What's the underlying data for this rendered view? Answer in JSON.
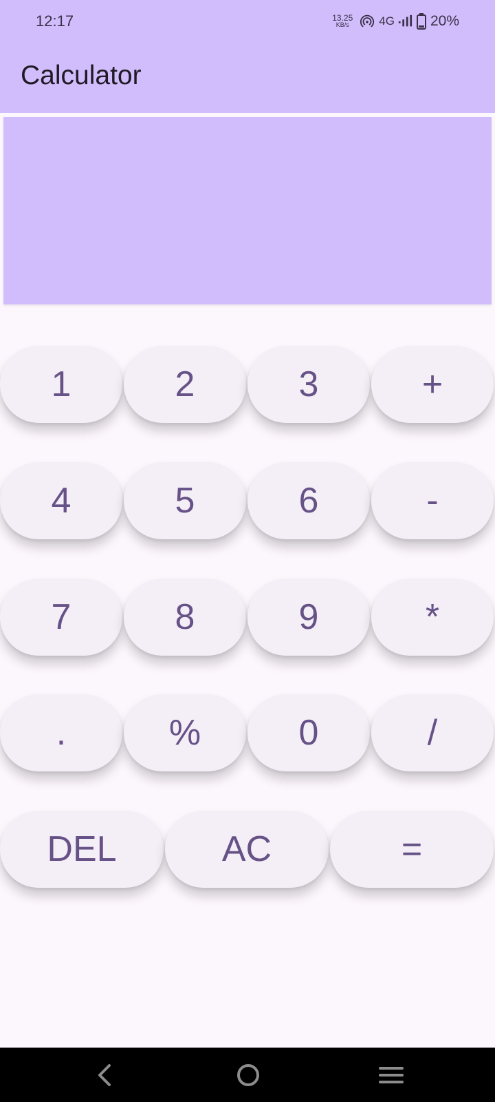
{
  "status_bar": {
    "time": "12:17",
    "net_speed_value": "13.25",
    "net_speed_unit": "KB/s",
    "network_type": "4G",
    "battery": "20%",
    "icons": [
      "hotspot-icon",
      "signal-icon",
      "battery-icon"
    ]
  },
  "app_bar": {
    "title": "Calculator"
  },
  "display": {
    "expression": "",
    "result": ""
  },
  "keypad": {
    "row1": [
      "1",
      "2",
      "3",
      "+"
    ],
    "row2": [
      "4",
      "5",
      "6",
      "-"
    ],
    "row3": [
      "7",
      "8",
      "9",
      "*"
    ],
    "row4": [
      ".",
      "%",
      "0",
      "/"
    ],
    "row5": [
      "DEL",
      "AC",
      "="
    ]
  },
  "nav_bar": {
    "icons": [
      "back-icon",
      "home-icon",
      "recents-icon"
    ]
  },
  "colors": {
    "accent": "#d2bdfc",
    "background": "#fcf7fd",
    "key_background": "#f4eff7",
    "key_text": "#665287"
  }
}
